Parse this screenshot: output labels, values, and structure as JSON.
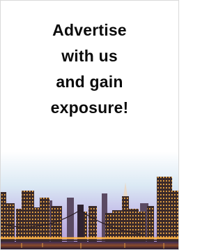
{
  "ad": {
    "headline_lines": [
      "Advertise",
      "with us",
      "and gain",
      "exposure!"
    ]
  },
  "image": {
    "subject": "night-city-skyline-with-bridge"
  },
  "colors": {
    "text": "#0b0b0b",
    "border": "#d9d9d9",
    "sky_top": "#ffffff",
    "sky_bottom": "#cdb6e6",
    "lights": "#ffb347"
  }
}
